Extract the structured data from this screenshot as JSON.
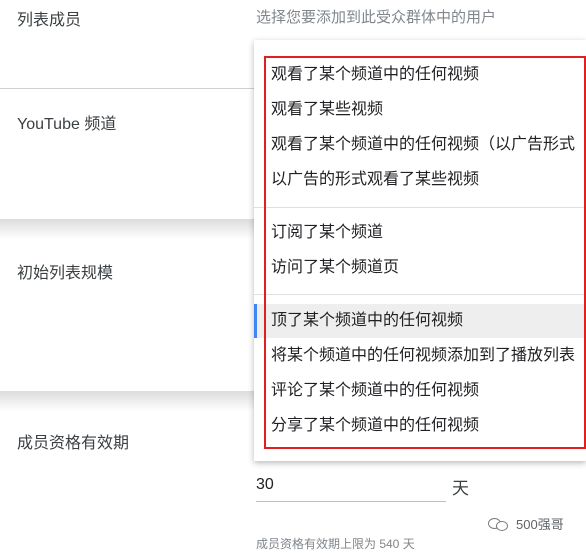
{
  "fields": {
    "list_members": "列表成员",
    "youtube_channel": "YouTube 频道",
    "initial_list_size": "初始列表规模",
    "membership_duration": "成员资格有效期"
  },
  "hint": "选择您要添加到此受众群体中的用户",
  "menu": {
    "group1": [
      "观看了某个频道中的任何视频",
      "观看了某些视频",
      "观看了某个频道中的任何视频（以广告形式",
      "以广告的形式观看了某些视频"
    ],
    "group2": [
      "订阅了某个频道",
      "访问了某个频道页"
    ],
    "group3": [
      "顶了某个频道中的任何视频",
      "将某个频道中的任何视频添加到了播放列表",
      "评论了某个频道中的任何视频",
      "分享了某个频道中的任何视频"
    ],
    "hovered_item": "顶了某个频道中的任何视频"
  },
  "duration": {
    "value": "30",
    "unit": "天",
    "limit_note": "成员资格有效期上限为 540 天"
  },
  "watermark": {
    "text": "500强哥",
    "icon": "wechat-icon"
  },
  "colors": {
    "highlight_border": "#e02020",
    "hover_indicator": "#4285f4"
  }
}
